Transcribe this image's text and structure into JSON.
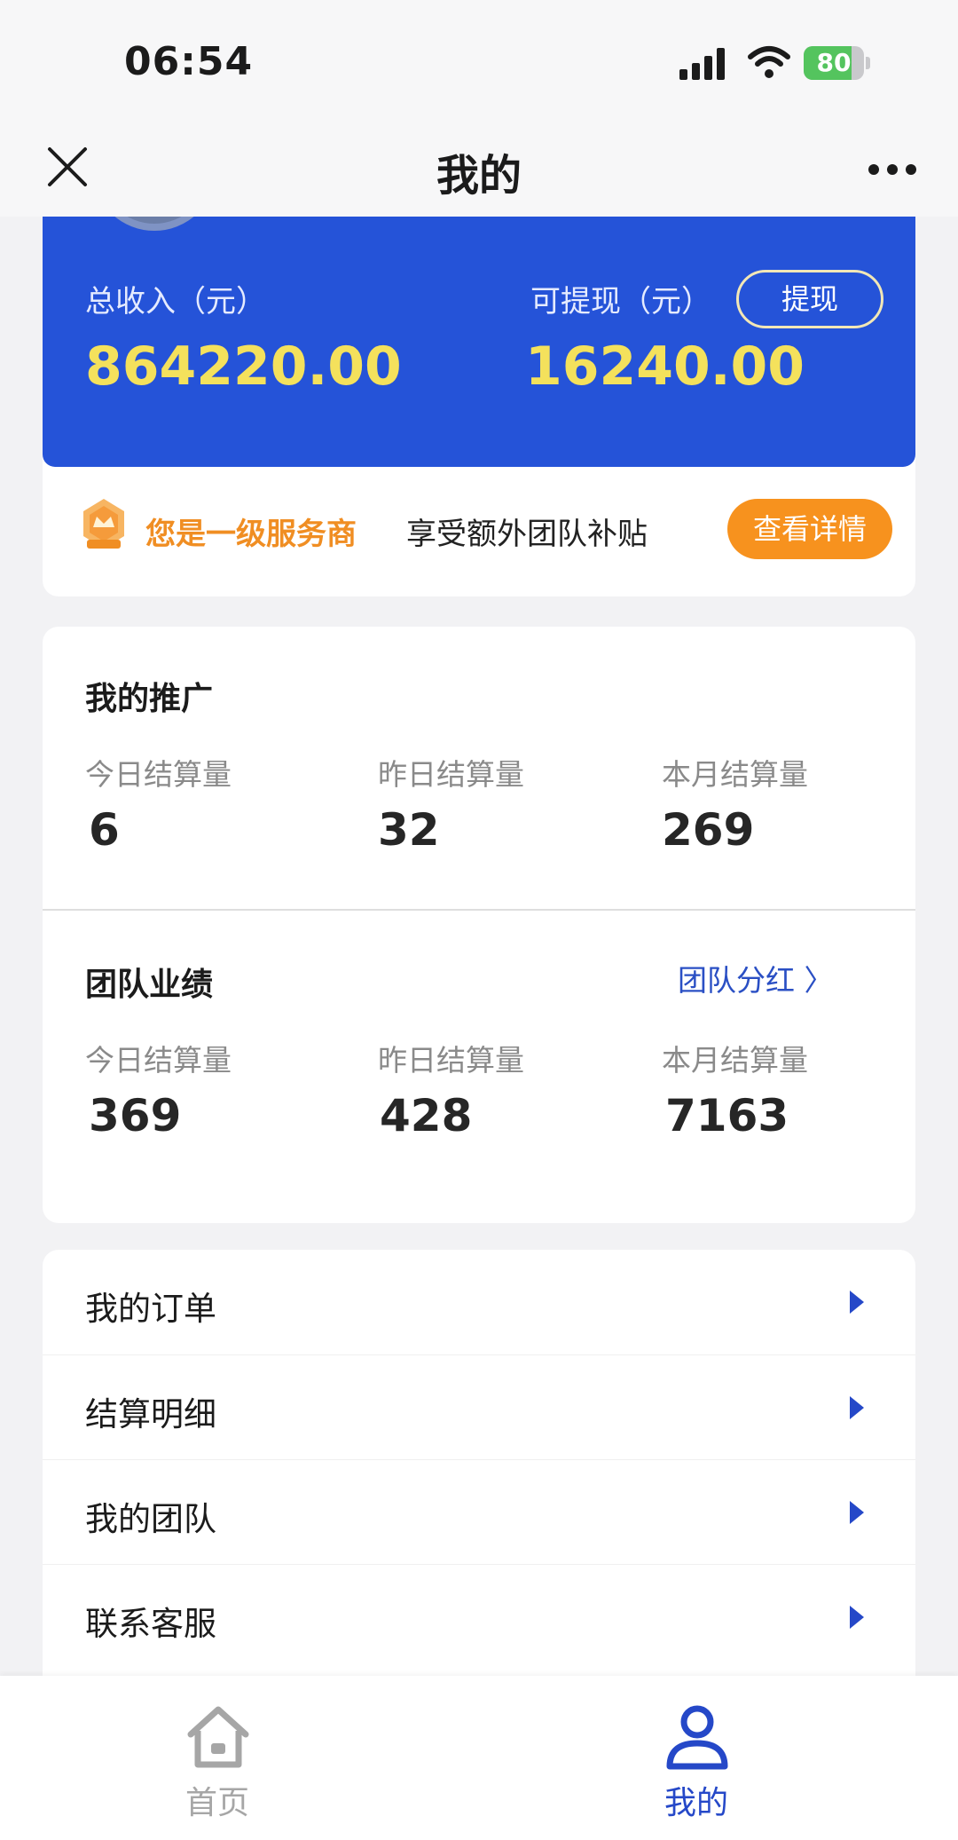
{
  "status_bar": {
    "time": "06:54",
    "battery_level": "80",
    "battery_fraction": 0.8,
    "icons": [
      "signal-icon",
      "wifi-icon",
      "battery-icon"
    ]
  },
  "nav": {
    "title": "我的",
    "icons": [
      "close-icon",
      "more-icon"
    ]
  },
  "income": {
    "total_label": "总收入（元）",
    "total_value": "864220.00",
    "withdrawable_label": "可提现（元）",
    "withdrawable_value": "16240.00",
    "withdraw_button": "提现"
  },
  "level": {
    "title": "您是一级服务商",
    "description": "享受额外团队补贴",
    "detail_button": "查看详情"
  },
  "promotion": {
    "title": "我的推广",
    "stats": [
      {
        "label": "今日结算量",
        "value": "6"
      },
      {
        "label": "昨日结算量",
        "value": "32"
      },
      {
        "label": "本月结算量",
        "value": "269"
      }
    ]
  },
  "team": {
    "title": "团队业绩",
    "link": "团队分红 〉",
    "stats": [
      {
        "label": "今日结算量",
        "value": "369"
      },
      {
        "label": "昨日结算量",
        "value": "428"
      },
      {
        "label": "本月结算量",
        "value": "7163"
      }
    ]
  },
  "menu": {
    "items": [
      {
        "label": "我的订单"
      },
      {
        "label": "结算明细"
      },
      {
        "label": "我的团队"
      },
      {
        "label": "联系客服"
      }
    ]
  },
  "tabbar": {
    "tabs": [
      {
        "label": "首页",
        "icon": "home-icon",
        "active": false
      },
      {
        "label": "我的",
        "icon": "user-icon",
        "active": true
      }
    ]
  },
  "colors": {
    "brand_blue": "#2553d8",
    "income_yellow": "#f4e15c",
    "accent_orange": "#f7921e",
    "active_tab": "#2548c8",
    "inactive_tab": "#a6a6a6"
  }
}
